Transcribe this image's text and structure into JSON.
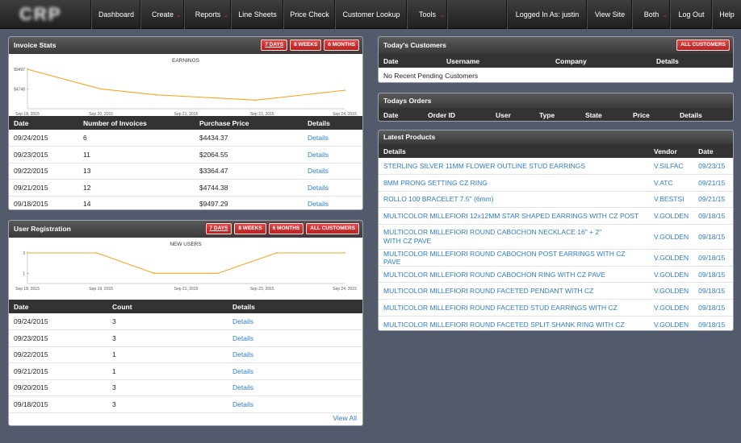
{
  "nav": {
    "logo": "CRP",
    "items": [
      {
        "label": "Dashboard",
        "caret": false
      },
      {
        "label": "Create",
        "caret": true
      },
      {
        "label": "Reports",
        "caret": true
      },
      {
        "label": "Line Sheets",
        "caret": false
      },
      {
        "label": "Price Check",
        "caret": false
      },
      {
        "label": "Customer Lookup",
        "caret": false
      },
      {
        "label": "Tools",
        "caret": true
      }
    ],
    "right_items": [
      {
        "label": "Logged In As: justin",
        "caret": false
      },
      {
        "label": "View Site",
        "caret": false
      },
      {
        "label": "Both",
        "caret": true
      },
      {
        "label": "Log Out",
        "caret": false
      },
      {
        "label": "Help",
        "caret": false
      }
    ]
  },
  "invoice_stats": {
    "title": "Invoice Stats",
    "buttons": [
      "7 DAYS",
      "8 WEEKS",
      "6 MONTHS"
    ],
    "chart": {
      "title": "EARNINGS",
      "y_ticks": [
        "$9497",
        "$4748"
      ],
      "x_ticks": [
        "Sep 18, 2015",
        "Sep 20, 2015",
        "Sep 21, 2015",
        "Sep 23, 2015",
        "Sep 24, 2015"
      ]
    },
    "columns": [
      "Date",
      "Number of Invoices",
      "Purchase Price",
      "Details"
    ],
    "rows": [
      [
        "09/24/2015",
        "6",
        "$4434.37",
        "Details"
      ],
      [
        "09/23/2015",
        "11",
        "$2064.55",
        "Details"
      ],
      [
        "09/22/2015",
        "13",
        "$3364.47",
        "Details"
      ],
      [
        "09/21/2015",
        "12",
        "$4744.38",
        "Details"
      ],
      [
        "09/18/2015",
        "14",
        "$9497.29",
        "Details"
      ]
    ]
  },
  "user_registration": {
    "title": "User Registration",
    "buttons": [
      "7 DAYS",
      "8 WEEKS",
      "6 MONTHS",
      "ALL CUSTOMERS"
    ],
    "chart": {
      "title": "NEW USERS",
      "y_ticks": [
        "3",
        "1"
      ],
      "x_ticks": [
        "Sep 18, 2015",
        "Sep 19, 2015",
        "Sep 21, 2015",
        "Sep 23, 2015",
        "Sep 24, 2015"
      ]
    },
    "columns": [
      "Date",
      "Count",
      "Details"
    ],
    "rows": [
      [
        "09/24/2015",
        "3",
        "Details"
      ],
      [
        "09/23/2015",
        "3",
        "Details"
      ],
      [
        "09/22/2015",
        "1",
        "Details"
      ],
      [
        "09/21/2015",
        "1",
        "Details"
      ],
      [
        "09/20/2015",
        "3",
        "Details"
      ],
      [
        "09/18/2015",
        "3",
        "Details"
      ]
    ],
    "view_all": "View All"
  },
  "todays_customers": {
    "title": "Today's Customers",
    "button": "ALL CUSTOMERS",
    "columns": [
      "Date",
      "Username",
      "Company",
      "Details"
    ],
    "empty": "No Recent Pending Customers"
  },
  "todays_orders": {
    "title": "Todays Orders",
    "columns": [
      "Date",
      "Order ID",
      "User",
      "Type",
      "State",
      "Price",
      "Details"
    ]
  },
  "latest_products": {
    "title": "Latest Products",
    "columns": [
      "Details",
      "Vendor",
      "Date"
    ],
    "rows": [
      [
        "STERLING SILVER 11MM FLOWER OUTLINE STUD EARRINGS",
        "V.SILFAC",
        "09/23/15"
      ],
      [
        "8MM PRONG SETTING CZ RING",
        "V.ATC",
        "09/21/15"
      ],
      [
        "ROLLO 100 BRACELET 7.5\" (6mm)",
        "V.BESTSI",
        "09/21/15"
      ],
      [
        "MULTICOLOR MILLEFIORI 12x12MM STAR SHAPED EARRINGS WITH CZ POST",
        "V.GOLDEN",
        "09/18/15"
      ],
      [
        "MULTICOLOR MILLEFIORI ROUND CABOCHON NECKLACE 16\" + 2\" WITH CZ PAVE",
        "V.GOLDEN",
        "09/18/15"
      ],
      [
        "MULTICOLOR MILLEFIORI ROUND CABOCHON POST EARRINGS WITH CZ PAVE",
        "V.GOLDEN",
        "09/18/15"
      ],
      [
        "MULTICOLOR MILLEFIORI ROUND CABOCHON RING WITH CZ PAVE",
        "V.GOLDEN",
        "09/18/15"
      ],
      [
        "MULTICOLOR MILLEFIORI ROUND FACETED PENDANT WITH CZ",
        "V.GOLDEN",
        "09/18/15"
      ],
      [
        "MULTICOLOR MILLEFIORI ROUND FACETED STUD EARRINGS WITH CZ",
        "V.GOLDEN",
        "09/18/15"
      ],
      [
        "MULTICOLOR MILLEFIORI ROUND FACETED SPLIT SHANK RING WITH CZ",
        "V.GOLDEN",
        "09/18/15"
      ]
    ]
  },
  "chart_data": [
    {
      "type": "line",
      "title": "EARNINGS",
      "x": [
        "Sep 18, 2015",
        "Sep 21, 2015",
        "Sep 22, 2015",
        "Sep 23, 2015",
        "Sep 24, 2015"
      ],
      "values": [
        9497.29,
        4744.38,
        3364.47,
        2064.55,
        4434.37
      ],
      "ylim": [
        0,
        9497
      ],
      "color": "#f5a623"
    },
    {
      "type": "line",
      "title": "NEW USERS",
      "x": [
        "Sep 18, 2015",
        "Sep 20, 2015",
        "Sep 21, 2015",
        "Sep 22, 2015",
        "Sep 23, 2015",
        "Sep 24, 2015"
      ],
      "values": [
        3,
        3,
        1,
        1,
        3,
        3
      ],
      "ylim": [
        0,
        3
      ],
      "color": "#f5a623"
    }
  ],
  "colors": {
    "background": "#525a6c",
    "accent_red": "#c62828",
    "link": "#2f7cc4",
    "line": "#f5a623"
  }
}
